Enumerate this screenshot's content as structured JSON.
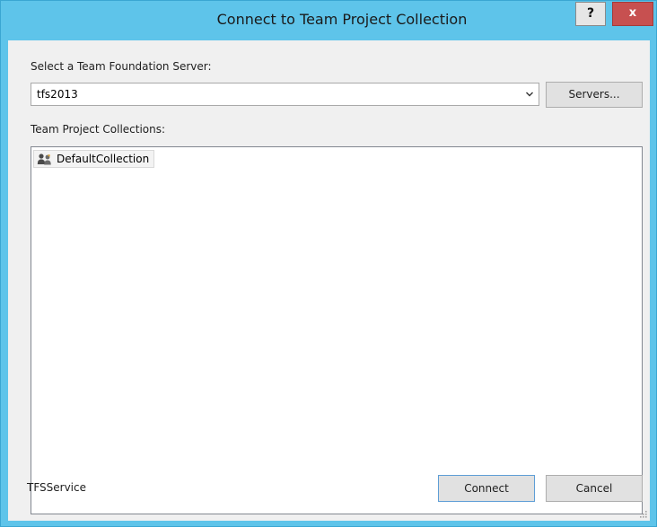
{
  "window": {
    "title": "Connect to Team Project Collection",
    "help_label": "?",
    "close_label": "x"
  },
  "server": {
    "label": "Select a Team Foundation Server:",
    "selected": "tfs2013",
    "servers_button": "Servers..."
  },
  "collections": {
    "label": "Team Project Collections:",
    "items": [
      {
        "label": "DefaultCollection",
        "icon": "team-group-icon"
      }
    ]
  },
  "footer": {
    "status": "TFSService",
    "connect_button": "Connect",
    "cancel_button": "Cancel"
  },
  "colors": {
    "title_bar": "#5ec4ea",
    "close_button": "#c75050",
    "client_background": "#f0f0f0"
  }
}
